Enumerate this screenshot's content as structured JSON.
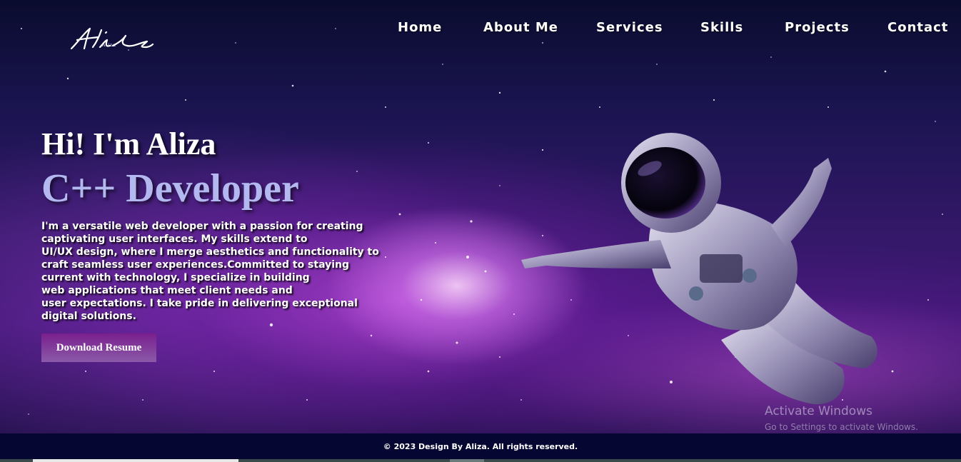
{
  "logo": {
    "text": "Aliza",
    "subtitle": "Aliza"
  },
  "nav": {
    "items": [
      "Home",
      "About Me",
      "Services",
      "Skills",
      "Projects",
      "Contact"
    ]
  },
  "hero": {
    "greeting": "Hi! I'm Aliza",
    "role": "C++ Developer",
    "bio_lines": [
      "I'm a versatile web developer with a passion for creating",
      "captivating user interfaces. My skills extend to",
      "UI/UX design, where I merge aesthetics and functionality to",
      "craft seamless user experiences.Committed to staying",
      "current with technology, I specialize in building",
      "web applications that meet client needs and",
      "user expectations. I take pride in delivering exceptional",
      "digital solutions."
    ],
    "resume_button": "Download Resume"
  },
  "watermark": {
    "title": "Activate Windows",
    "subtitle": "Go to Settings to activate Windows."
  },
  "footer": {
    "text": "© 2023 Design By Aliza. All rights reserved."
  },
  "colors": {
    "role_text": "#b3b9f0",
    "button_top": "#7a1f8e",
    "button_bottom": "#8a5aa8",
    "footer_bg": "#060632"
  }
}
